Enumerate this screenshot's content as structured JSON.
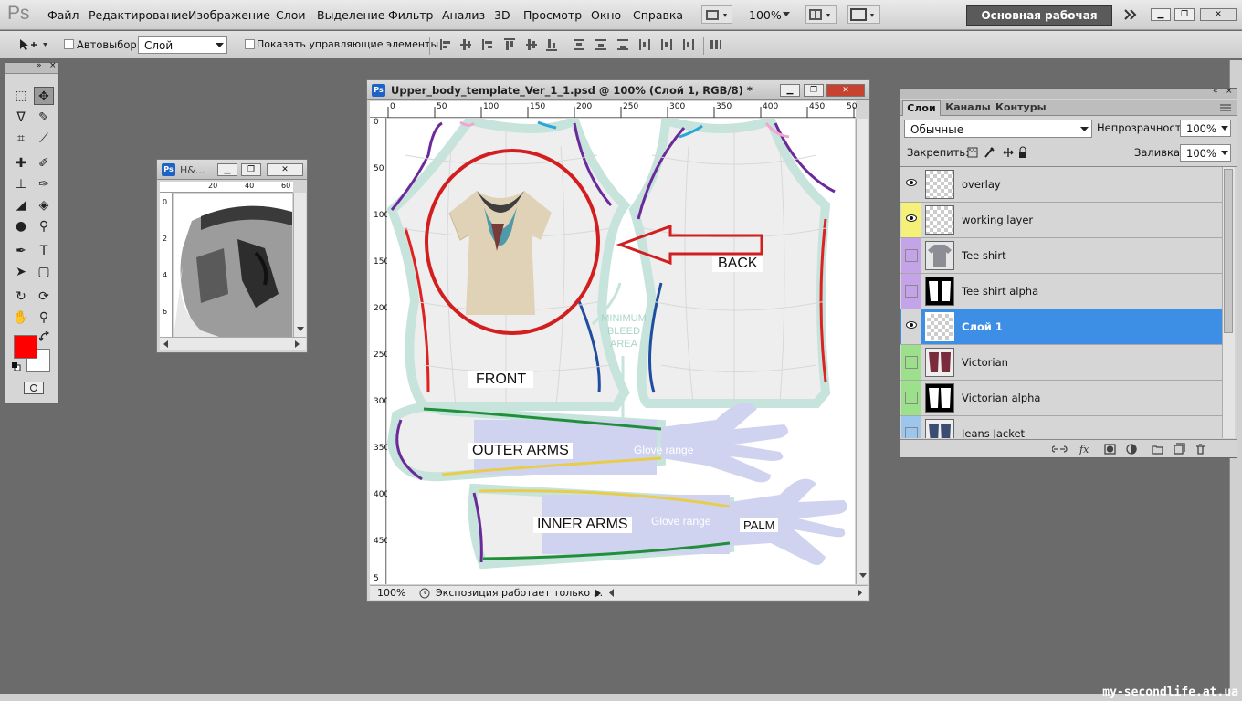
{
  "app": {
    "logo": "Ps"
  },
  "menubar": {
    "items": [
      "Файл",
      "Редактирование",
      "Изображение",
      "Слои",
      "Выделение",
      "Фильтр",
      "Анализ",
      "3D",
      "Просмотр",
      "Окно",
      "Справка"
    ],
    "zoom": "100%",
    "workspace": "Основная рабочая среда"
  },
  "options": {
    "autoselect_label": "Автовыбор:",
    "autoselect_value": "Слой",
    "show_controls_label": "Показать управляющие элементы"
  },
  "toolbox": {
    "foreground": "#ff0000",
    "background": "#ffffff"
  },
  "nav_window": {
    "title": "H&...",
    "ruler_ticks": [
      "20",
      "40",
      "60"
    ],
    "vticks": [
      "0",
      "2",
      "4",
      "6"
    ]
  },
  "document": {
    "title": "Upper_body_template_Ver_1_1.psd @ 100% (Слой 1, RGB/8) *",
    "ruler_ticks": [
      "0",
      "50",
      "100",
      "150",
      "200",
      "250",
      "300",
      "350",
      "400",
      "450",
      "50"
    ],
    "vruler_ticks": [
      "0",
      "50",
      "100",
      "150",
      "200",
      "250",
      "300",
      "350",
      "400",
      "450",
      "5"
    ],
    "labels": {
      "front": "FRONT",
      "back": "BACK",
      "bleed": "MINIMUM BLEED AREA",
      "outer_arms": "OUTER ARMS",
      "inner_arms": "INNER ARMS",
      "glove1": "Glove range",
      "glove2": "Glove range",
      "palm": "PALM"
    },
    "status_zoom": "100%",
    "status_text": "Экспозиция работает только ..."
  },
  "layers_panel": {
    "tabs": [
      "Слои",
      "Каналы",
      "Контуры"
    ],
    "blend_mode": "Обычные",
    "opacity_label": "Непрозрачность:",
    "opacity": "100%",
    "lock_label": "Закрепить:",
    "fill_label": "Заливка:",
    "fill": "100%",
    "layers": [
      {
        "name": "overlay",
        "visible": true,
        "color": "none",
        "thumb": "transparent"
      },
      {
        "name": "working layer",
        "visible": true,
        "color": "#f5f078",
        "thumb": "transparent"
      },
      {
        "name": "Tee shirt",
        "visible": false,
        "color": "#c5a3e8",
        "thumb": "shirt-gray"
      },
      {
        "name": "Tee shirt alpha",
        "visible": false,
        "color": "#c5a3e8",
        "thumb": "alpha-mask"
      },
      {
        "name": "Слой 1",
        "visible": true,
        "color": "none",
        "thumb": "transparent",
        "selected": true
      },
      {
        "name": "Victorian",
        "visible": false,
        "color": "#9de08c",
        "thumb": "victorian"
      },
      {
        "name": "Victorian alpha",
        "visible": false,
        "color": "#9de08c",
        "thumb": "alpha-mask"
      },
      {
        "name": "Jeans Jacket",
        "visible": false,
        "color": "#9cc6ee",
        "thumb": "jacket"
      }
    ],
    "footer_icons": [
      "link-icon",
      "fx-icon",
      "mask-icon",
      "adjustment-icon",
      "group-icon",
      "new-layer-icon",
      "trash-icon"
    ]
  },
  "watermark": "my-secondlife.at.ua"
}
